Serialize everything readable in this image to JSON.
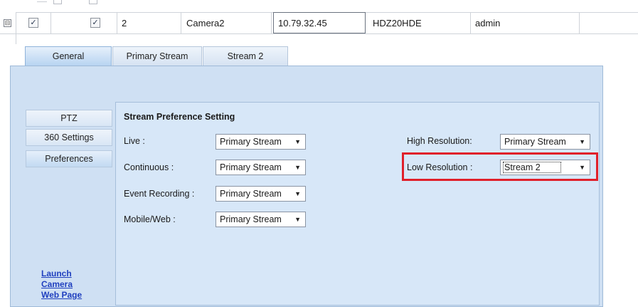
{
  "grid": {
    "row": {
      "expand_glyph": "⊟",
      "check1": "✓",
      "check2": "✓",
      "id": "2",
      "name": "Camera2",
      "ip": "10.79.32.45",
      "model": "HDZ20HDE",
      "user": "admin"
    }
  },
  "tabs": [
    {
      "label": "General",
      "active": true
    },
    {
      "label": "Primary Stream",
      "active": false
    },
    {
      "label": "Stream 2",
      "active": false
    }
  ],
  "sidebar": {
    "items": [
      {
        "label": "PTZ"
      },
      {
        "label": "360 Settings"
      },
      {
        "label": "Preferences",
        "selected": true
      }
    ],
    "link_lines": [
      "Launch",
      "Camera",
      "Web Page"
    ]
  },
  "stream_pref": {
    "title": "Stream Preference Setting",
    "fields": [
      {
        "label": "Live :",
        "value": "Primary Stream"
      },
      {
        "label": "Continuous :",
        "value": "Primary Stream"
      },
      {
        "label": "Event Recording :",
        "value": "Primary Stream"
      },
      {
        "label": "Mobile/Web :",
        "value": "Primary Stream"
      }
    ],
    "right_fields": [
      {
        "label": "High Resolution:",
        "value": "Primary Stream"
      },
      {
        "label": "Low Resolution :",
        "value": "Stream 2"
      }
    ],
    "dropdown_arrow": "▼"
  },
  "colors": {
    "highlight": "#e0202a",
    "panel": "#cfe0f3",
    "link": "#1f3fbf"
  }
}
